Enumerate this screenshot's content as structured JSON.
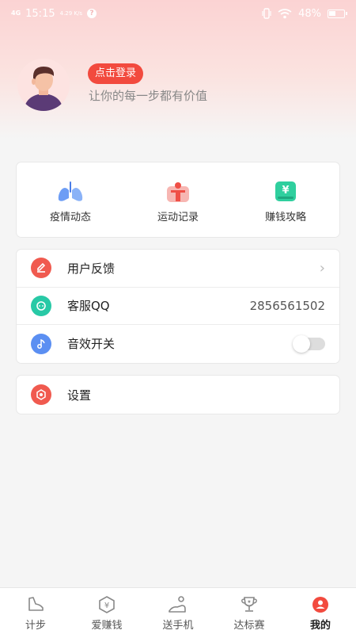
{
  "status_bar": {
    "network": "4G",
    "time": "15:15",
    "tiny_text": "4.29 K/s",
    "battery": "48%",
    "battery_level": 0.48
  },
  "profile": {
    "login_button": "点击登录",
    "slogan": "让你的每一步都有价值"
  },
  "quick_actions": [
    {
      "label": "疫情动态",
      "icon": "lungs-icon"
    },
    {
      "label": "运动记录",
      "icon": "person-icon"
    },
    {
      "label": "赚钱攻略",
      "icon": "yen-icon"
    }
  ],
  "menu": [
    {
      "label": "用户反馈",
      "icon": "edit-icon",
      "color": "#f05a4f"
    },
    {
      "label": "客服QQ",
      "icon": "chat-icon",
      "color": "#28c9a6",
      "value": "2856561502"
    },
    {
      "label": "音效开关",
      "icon": "music-icon",
      "color": "#5b8ff2"
    }
  ],
  "settings": {
    "label": "设置",
    "icon": "gear-icon",
    "color": "#f05a4f"
  },
  "tabs": [
    {
      "label": "计步",
      "icon": "shoe-icon",
      "active": false
    },
    {
      "label": "爱赚钱",
      "icon": "coin-icon",
      "active": false
    },
    {
      "label": "送手机",
      "icon": "phone-hand-icon",
      "active": false
    },
    {
      "label": "达标赛",
      "icon": "trophy-icon",
      "active": false
    },
    {
      "label": "我的",
      "icon": "user-icon",
      "active": true
    }
  ],
  "colors": {
    "accent": "#f24a3e",
    "header_gradient_top": "#fbd3d3",
    "background": "#f5f5f5"
  }
}
